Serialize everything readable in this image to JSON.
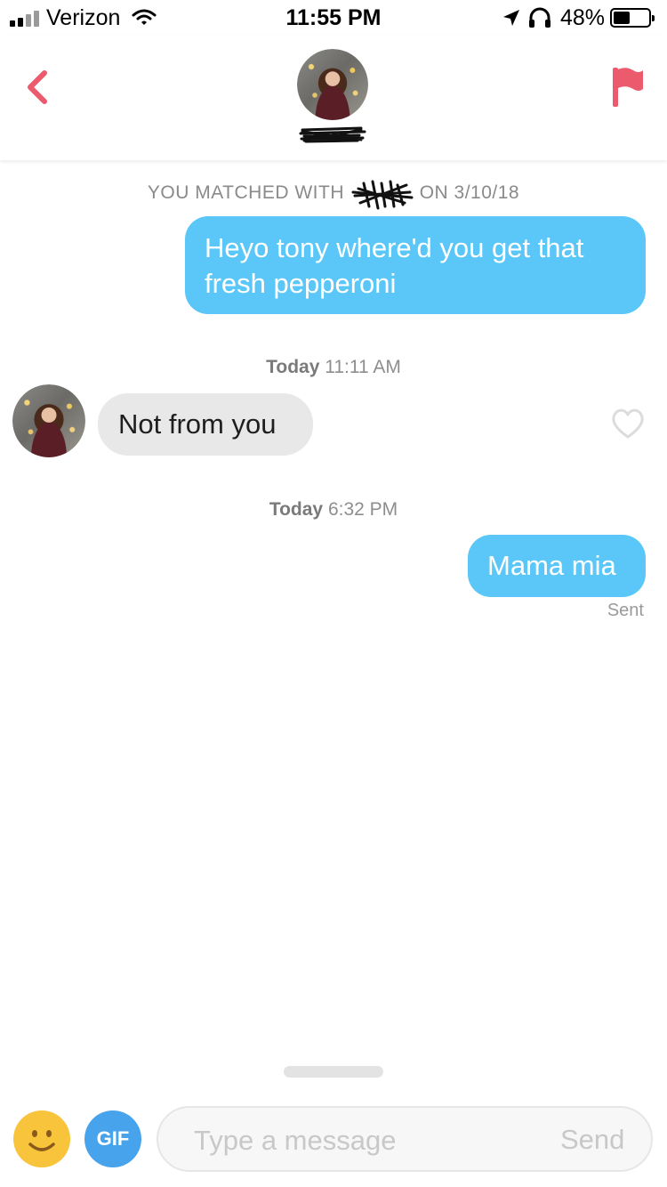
{
  "status_bar": {
    "carrier": "Verizon",
    "time": "11:55 PM",
    "battery": "48%",
    "battery_level": 0.48
  },
  "header": {
    "back_icon": "chevron-left-icon",
    "report_icon": "flag-icon",
    "accent_color": "#ec5a6e"
  },
  "chat": {
    "match_prefix": "YOU MATCHED WITH",
    "match_date": "ON 3/10/18",
    "messages": [
      {
        "direction": "outgoing",
        "text": "Heyo tony where'd you get that fresh pepperoni"
      },
      {
        "direction": "incoming",
        "stamp_day": "Today",
        "stamp_time": "11:11 AM",
        "text": "Not from you"
      },
      {
        "direction": "outgoing",
        "stamp_day": "Today",
        "stamp_time": "6:32 PM",
        "text": "Mama mia",
        "status": "Sent"
      }
    ],
    "outgoing_color": "#5bc7f8",
    "incoming_color": "#e8e8e8"
  },
  "composer": {
    "gif_label": "GIF",
    "placeholder": "Type a message",
    "send_label": "Send"
  }
}
